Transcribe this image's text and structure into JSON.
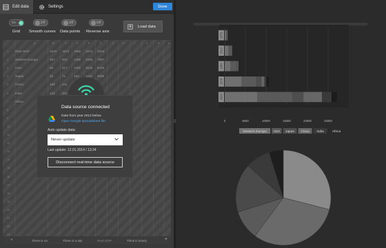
{
  "topbar": {
    "tab_edit": "Edit data",
    "tab_settings": "Settings",
    "done": "Done"
  },
  "toolbar": {
    "toggles": [
      {
        "label": "Grid",
        "state": "On"
      },
      {
        "label": "Smooth curves",
        "state": "Off"
      },
      {
        "label": "Data points",
        "state": "Off"
      },
      {
        "label": "Reverse axis",
        "state": "Off"
      }
    ],
    "load_data": "Load data"
  },
  "sheet": {
    "columns": [
      "A",
      "B",
      "C",
      "D",
      "E",
      "F",
      "G",
      "H",
      "I",
      "J",
      "K",
      "L"
    ],
    "rows": [
      [
        "Real GDP",
        "1870",
        "1913",
        "1950",
        "1973",
        "2003"
      ],
      [
        "Western Europe",
        "367",
        "902",
        "1396",
        "4096",
        "7857"
      ],
      [
        "USA",
        "98",
        "517",
        "1455",
        "3536",
        "8430"
      ],
      [
        "Japan",
        "25",
        "71",
        "160",
        "1242",
        "2699"
      ],
      [
        "China",
        "189",
        "241",
        "",
        "",
        ""
      ],
      [
        "India",
        "134",
        "204",
        "",
        "",
        ""
      ],
      [
        "Africa",
        "",
        "",
        "",
        "",
        ""
      ]
    ],
    "row_count": 23,
    "tabs": [
      "There is no",
      "There is a tab",
      "Real GDP",
      "Think is lonely"
    ]
  },
  "dialog": {
    "title": "Data source connected",
    "source": "Data from year 2013 below",
    "link": "Open Google spreadsheet file",
    "auto_label": "Auto update data:",
    "select_value": "Never update",
    "last_update": "Last update: 12.01.2014 / 13:34",
    "disconnect": "Disconnect real-time data source"
  },
  "chart_data": [
    {
      "type": "bar",
      "orientation": "horizontal",
      "stacked": true,
      "categories": [
        "1870",
        "1913",
        "1950",
        "1973",
        "2003"
      ],
      "series": [
        {
          "name": "Western Europe",
          "values": [
            370,
            900,
            1400,
            4100,
            7900
          ]
        },
        {
          "name": "USA",
          "values": [
            100,
            520,
            1460,
            3540,
            8430
          ]
        },
        {
          "name": "Japan",
          "values": [
            25,
            70,
            160,
            1240,
            2700
          ]
        },
        {
          "name": "China",
          "values": [
            190,
            240,
            240,
            700,
            4500
          ]
        },
        {
          "name": "India",
          "values": [
            135,
            205,
            220,
            500,
            2300
          ]
        },
        {
          "name": "Africa",
          "values": [
            45,
            80,
            200,
            550,
            1300
          ]
        }
      ],
      "xlim": [
        0,
        28000
      ],
      "xticks": [
        "0",
        "5000",
        "10000",
        "15000",
        "20000",
        "25000"
      ],
      "grid": true,
      "legend_placement": "bottom",
      "colors": [
        "#707070",
        "#5a5a5a",
        "#4e4e4e",
        "#666666",
        "#3a3a3a",
        "#1c1c1c"
      ]
    },
    {
      "type": "pie",
      "labels": [
        "Western Europe",
        "USA",
        "Japan",
        "China",
        "India",
        "Africa"
      ],
      "values": [
        7857,
        8430,
        2699,
        4500,
        2300,
        1300
      ],
      "colors": [
        "#8a8a8a",
        "#6a6a6a",
        "#5a5a5a",
        "#4a4a4a",
        "#3a3a3a",
        "#1e1e1e"
      ]
    }
  ],
  "colors": {
    "accent": "#2f86d8",
    "toggle_on": "#7fe1c6",
    "link": "#54a9ef"
  }
}
